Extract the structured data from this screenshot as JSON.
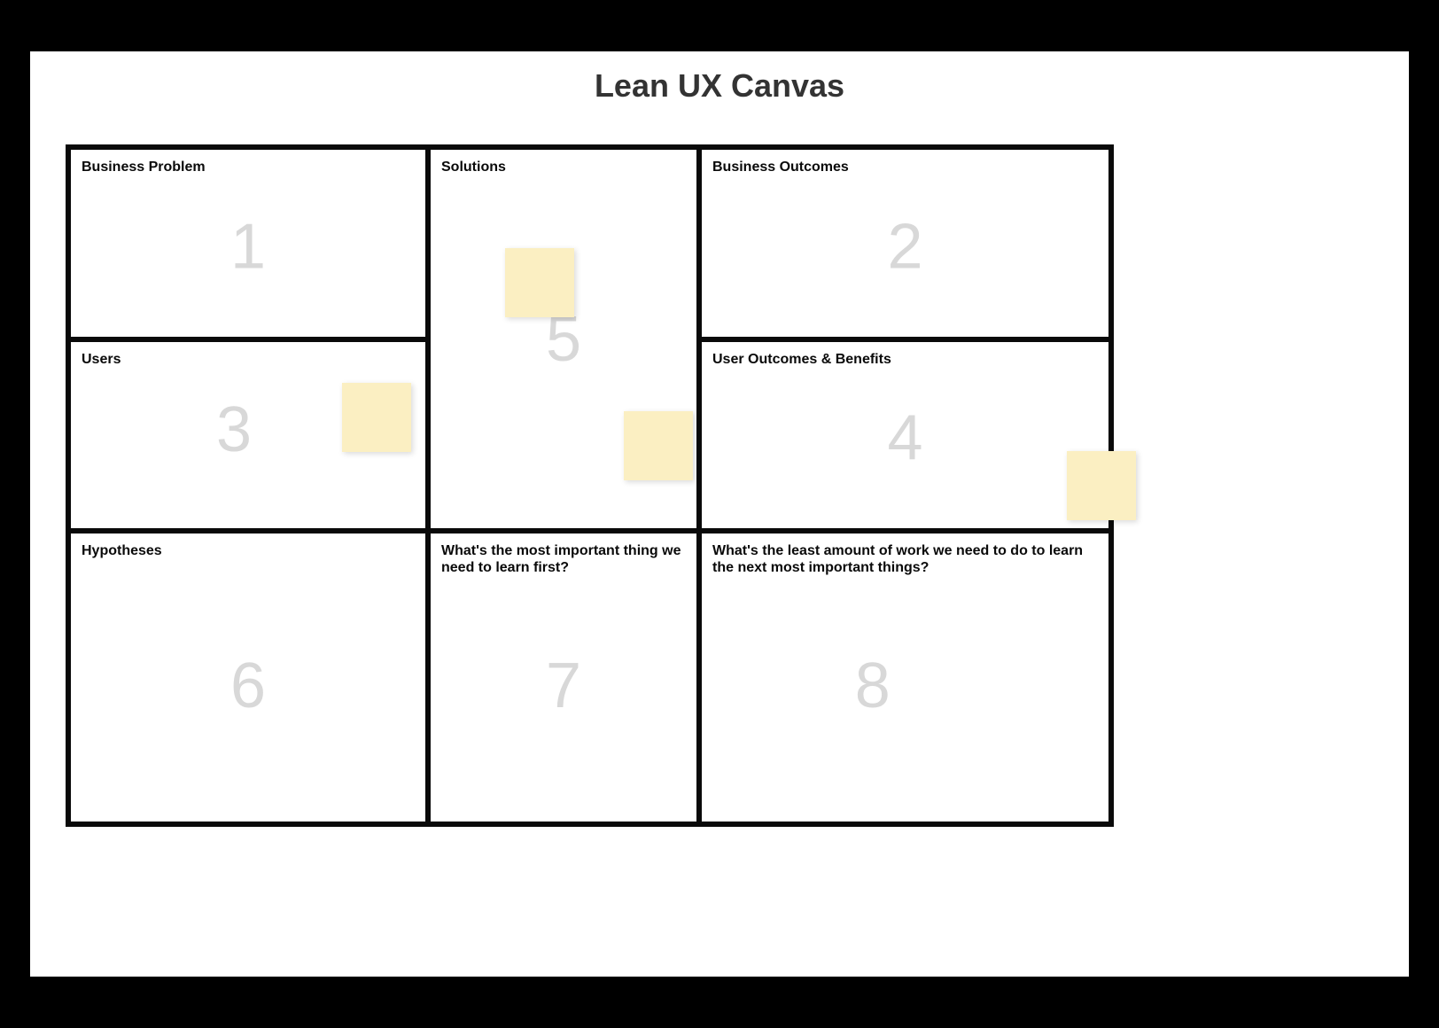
{
  "title": "Lean UX Canvas",
  "cells": {
    "c1": {
      "label": "Business Problem",
      "number": "1"
    },
    "c2": {
      "label": "Business Outcomes",
      "number": "2"
    },
    "c3": {
      "label": "Users",
      "number": "3"
    },
    "c4": {
      "label": "User Outcomes & Benefits",
      "number": "4"
    },
    "c5": {
      "label": "Solutions",
      "number": "5"
    },
    "c6": {
      "label": "Hypotheses",
      "number": "6"
    },
    "c7": {
      "label": "What's the most important thing we need to learn first?",
      "number": "7"
    },
    "c8": {
      "label": "What's the least amount of work we need to do to learn the next most important things?",
      "number": "8"
    }
  }
}
